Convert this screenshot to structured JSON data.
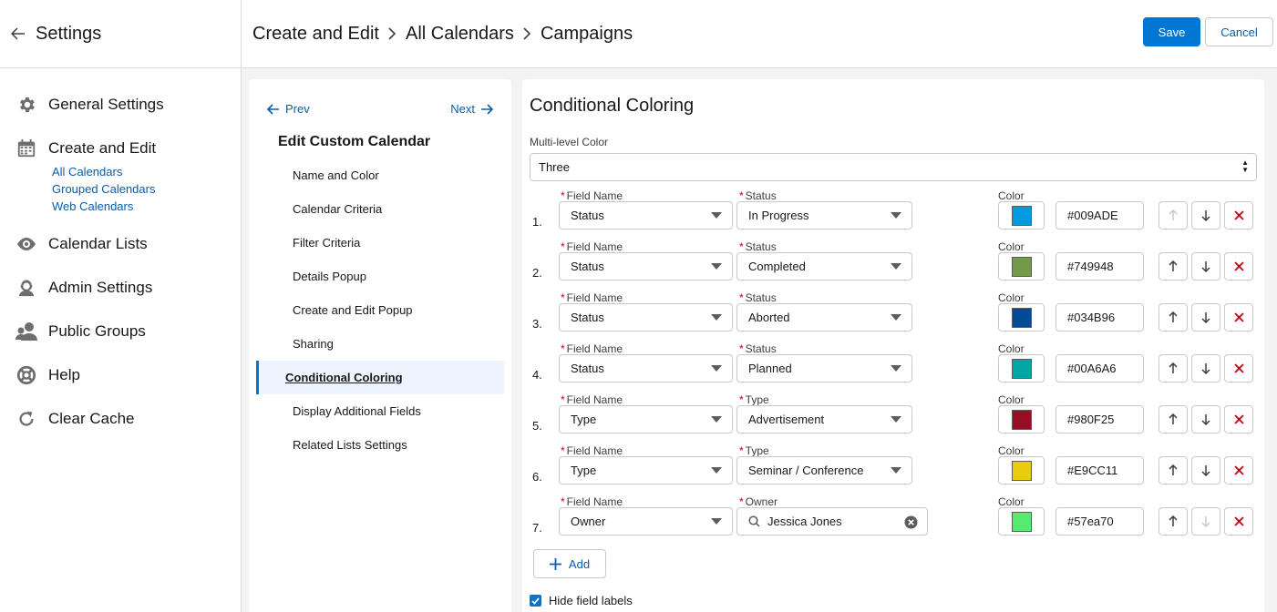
{
  "sidebar": {
    "title": "Settings",
    "items": [
      {
        "label": "General Settings",
        "icon": "gear-icon"
      },
      {
        "label": "Create and Edit",
        "icon": "calendar-icon"
      },
      {
        "label": "Calendar Lists",
        "icon": "eye-icon"
      },
      {
        "label": "Admin Settings",
        "icon": "admin-icon"
      },
      {
        "label": "Public Groups",
        "icon": "group-icon"
      },
      {
        "label": "Help",
        "icon": "lifebuoy-icon"
      },
      {
        "label": "Clear Cache",
        "icon": "refresh-icon"
      }
    ],
    "sub_items": [
      "All Calendars",
      "Grouped Calendars",
      "Web Calendars"
    ]
  },
  "header": {
    "breadcrumbs": [
      "Create and Edit",
      "All Calendars",
      "Campaigns"
    ],
    "save_label": "Save",
    "cancel_label": "Cancel"
  },
  "steps": {
    "prev_label": "Prev",
    "next_label": "Next",
    "title": "Edit Custom Calendar",
    "items": [
      "Name and Color",
      "Calendar Criteria",
      "Filter Criteria",
      "Details Popup",
      "Create and Edit Popup",
      "Sharing",
      "Conditional Coloring",
      "Display Additional Fields",
      "Related Lists Settings"
    ],
    "active_index": 6
  },
  "main": {
    "title": "Conditional Coloring",
    "multilevel_label": "Multi-level Color",
    "multilevel_value": "Three",
    "field_name_label": "Field Name",
    "color_label": "Color",
    "rows": [
      {
        "num": "1.",
        "field": "Status",
        "value_label": "Status",
        "value": "In Progress",
        "color": "#009ADE",
        "hex": "#009ADE"
      },
      {
        "num": "2.",
        "field": "Status",
        "value_label": "Status",
        "value": "Completed",
        "color": "#749948",
        "hex": "#749948"
      },
      {
        "num": "3.",
        "field": "Status",
        "value_label": "Status",
        "value": "Aborted",
        "color": "#034B96",
        "hex": "#034B96"
      },
      {
        "num": "4.",
        "field": "Status",
        "value_label": "Status",
        "value": "Planned",
        "color": "#00A6A6",
        "hex": "#00A6A6"
      },
      {
        "num": "5.",
        "field": "Type",
        "value_label": "Type",
        "value": "Advertisement",
        "color": "#980F25",
        "hex": "#980F25"
      },
      {
        "num": "6.",
        "field": "Type",
        "value_label": "Type",
        "value": "Seminar / Conference",
        "color": "#E9CC11",
        "hex": "#E9CC11"
      },
      {
        "num": "7.",
        "field": "Owner",
        "value_label": "Owner",
        "value": "Jessica Jones",
        "color": "#57ea70",
        "hex": "#57ea70"
      }
    ],
    "add_label": "Add",
    "hide_labels_text": "Hide field labels",
    "required_mark": "*"
  },
  "colors": {
    "brand": "#0176d3",
    "link": "#0b5cab",
    "required": "#ba0517",
    "delete": "#ba0517"
  }
}
